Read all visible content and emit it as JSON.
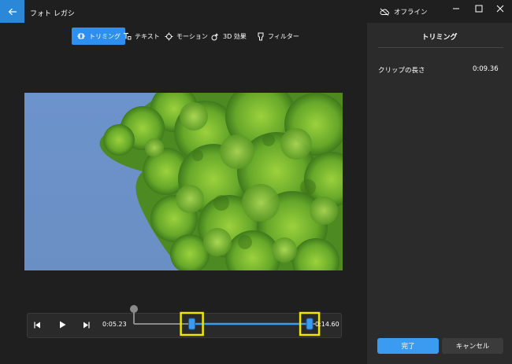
{
  "app": {
    "title": "フォト レガシ"
  },
  "toolbar": {
    "items": [
      {
        "label": "トリミング",
        "icon": "trim-icon",
        "active": true
      },
      {
        "label": "テキスト",
        "icon": "text-icon"
      },
      {
        "label": "モーション",
        "icon": "motion-icon"
      },
      {
        "label": "3D 効果",
        "icon": "3d-effects-icon"
      },
      {
        "label": "フィルター",
        "icon": "filter-icon"
      }
    ]
  },
  "window": {
    "status_label": "オフライン",
    "status_icon": "cloud-offline-icon"
  },
  "playback": {
    "start_time": "0:05.23",
    "end_time": "0:14.60",
    "playhead_fraction": 0.0,
    "trim_start_fraction": 0.32,
    "trim_end_fraction": 0.97
  },
  "panel": {
    "title": "トリミング",
    "clip_length_label": "クリップの長さ",
    "clip_length_value": "0:09.36",
    "done_label": "完了",
    "cancel_label": "キャンセル"
  },
  "colors": {
    "accent": "#2e8ff0",
    "highlight_box": "#f2e600",
    "background": "#1f1f1f",
    "panel": "#2b2b2b"
  }
}
